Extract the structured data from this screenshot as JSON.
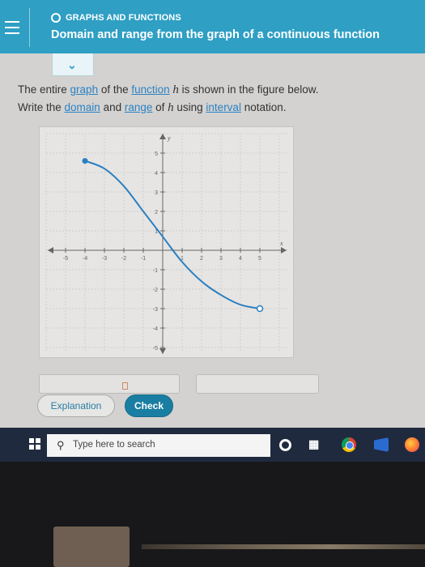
{
  "header": {
    "topic": "GRAPHS AND FUNCTIONS",
    "title": "Domain and range from the graph of a continuous function",
    "accent_color": "#2f9fc4"
  },
  "toggle": {
    "icon": "chevron-down-icon"
  },
  "question": {
    "t1": "The entire ",
    "graph_link": "graph",
    "t2": " of the ",
    "function_link": "function",
    "t3": " ",
    "var1": "h",
    "t4": " is shown in the figure below.",
    "t5": "Write the ",
    "domain_link": "domain",
    "t6": " and ",
    "range_link": "range",
    "t7": " of ",
    "var2": "h",
    "t8": " using ",
    "interval_link": "interval",
    "t9": " notation."
  },
  "graph": {
    "x_label": "x",
    "y_label": "y",
    "x_ticks": [
      "-5",
      "-4",
      "-3",
      "-2",
      "-1",
      "1",
      "2",
      "3",
      "4",
      "5"
    ],
    "y_ticks": [
      "5",
      "4",
      "3",
      "2",
      "1",
      "-1",
      "-2",
      "-3",
      "-4",
      "-5"
    ],
    "curve_color": "#2a7fc0",
    "start_point": {
      "x": -4,
      "y": 4.6,
      "filled": true
    },
    "end_point": {
      "x": 5,
      "y": -3,
      "filled": false
    },
    "curve_points": [
      [
        -4,
        4.6
      ],
      [
        -3,
        4.2
      ],
      [
        -2,
        3.3
      ],
      [
        -1,
        2
      ],
      [
        0,
        0.7
      ],
      [
        1,
        -0.6
      ],
      [
        2,
        -1.6
      ],
      [
        3,
        -2.3
      ],
      [
        4,
        -2.8
      ],
      [
        5,
        -3
      ]
    ]
  },
  "buttons": {
    "explanation": "Explanation",
    "check": "Check"
  },
  "taskbar": {
    "search_placeholder": "Type here to search"
  }
}
